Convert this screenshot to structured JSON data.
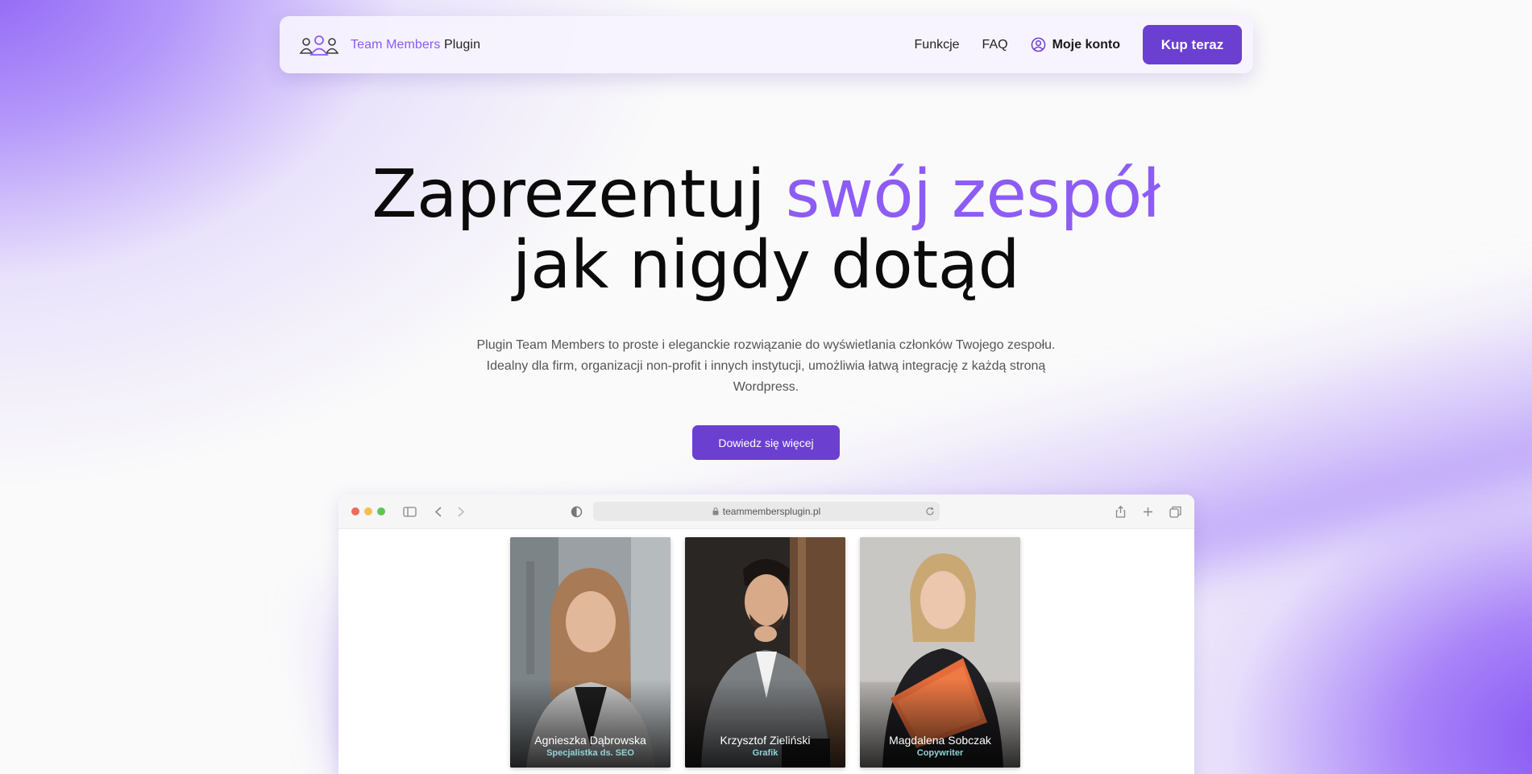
{
  "brand": {
    "name_part1": "Team Members",
    "name_part2": "Plugin",
    "logo_icon": "team-people-icon"
  },
  "nav": {
    "links": [
      "Funkcje",
      "FAQ"
    ],
    "account_label": "Moje konto",
    "account_icon": "user-circle-icon",
    "buy_label": "Kup teraz"
  },
  "hero": {
    "title_part1": "Zaprezentuj",
    "title_accent": "swój zespół",
    "title_part2": "jak nigdy dotąd",
    "lead": "Plugin Team Members to proste i eleganckie rozwiązanie do wyświetlania członków Twojego zespołu. Idealny dla firm, organizacji non-profit i innych instytucji, umożliwia łatwą integrację z każdą stroną Wordpress.",
    "cta_label": "Dowiedz się więcej"
  },
  "browser": {
    "url": "teammembersplugin.pl",
    "cards": [
      {
        "name": "Agnieszka Dąbrowska",
        "role": "Specjalistka ds. SEO"
      },
      {
        "name": "Krzysztof Zieliński",
        "role": "Grafik"
      },
      {
        "name": "Magdalena Sobczak",
        "role": "Copywriter"
      }
    ]
  },
  "colors": {
    "accent": "#8b5cf6",
    "button": "#6b3fd0",
    "role_text": "#8fd3d8"
  }
}
